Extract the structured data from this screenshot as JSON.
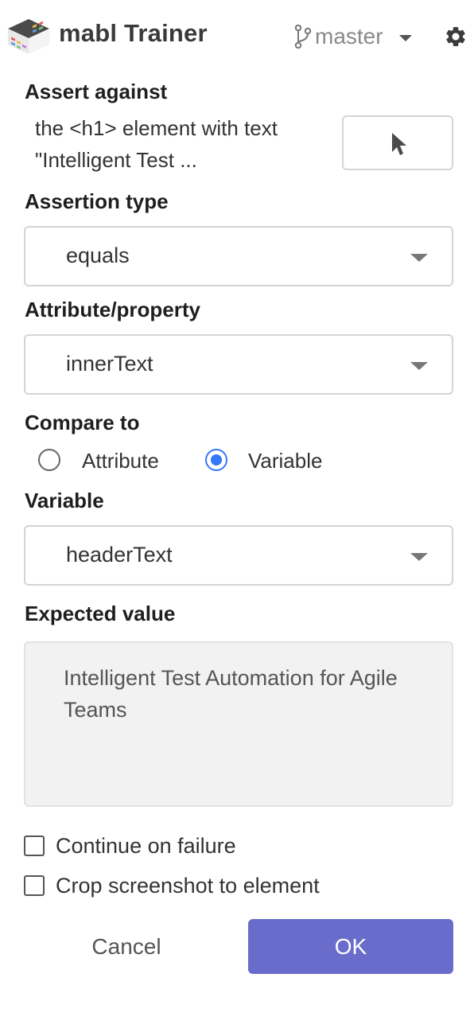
{
  "header": {
    "app_title": "mabl Trainer",
    "branch": "master",
    "logo_icon": "mabl-logo-icon",
    "branch_icon": "git-branch-icon",
    "settings_icon": "gear-icon"
  },
  "assert_against": {
    "label": "Assert against",
    "element_description": "the <h1> element with text \"Intelligent Test ...",
    "picker_icon": "cursor-pointer-icon"
  },
  "assertion_type": {
    "label": "Assertion type",
    "value": "equals"
  },
  "attribute": {
    "label": "Attribute/property",
    "value": "innerText"
  },
  "compare_to": {
    "label": "Compare to",
    "options": [
      {
        "label": "Attribute",
        "checked": false
      },
      {
        "label": "Variable",
        "checked": true
      }
    ]
  },
  "variable": {
    "label": "Variable",
    "value": "headerText"
  },
  "expected_value": {
    "label": "Expected value",
    "text": "Intelligent Test Automation for Agile Teams"
  },
  "options": {
    "continue_on_failure": {
      "label": "Continue on failure",
      "checked": false
    },
    "crop_screenshot": {
      "label": "Crop screenshot to element",
      "checked": false
    }
  },
  "buttons": {
    "cancel": "Cancel",
    "ok": "OK"
  },
  "colors": {
    "primary": "#6a6ccc",
    "radio_selected": "#3478f6"
  }
}
